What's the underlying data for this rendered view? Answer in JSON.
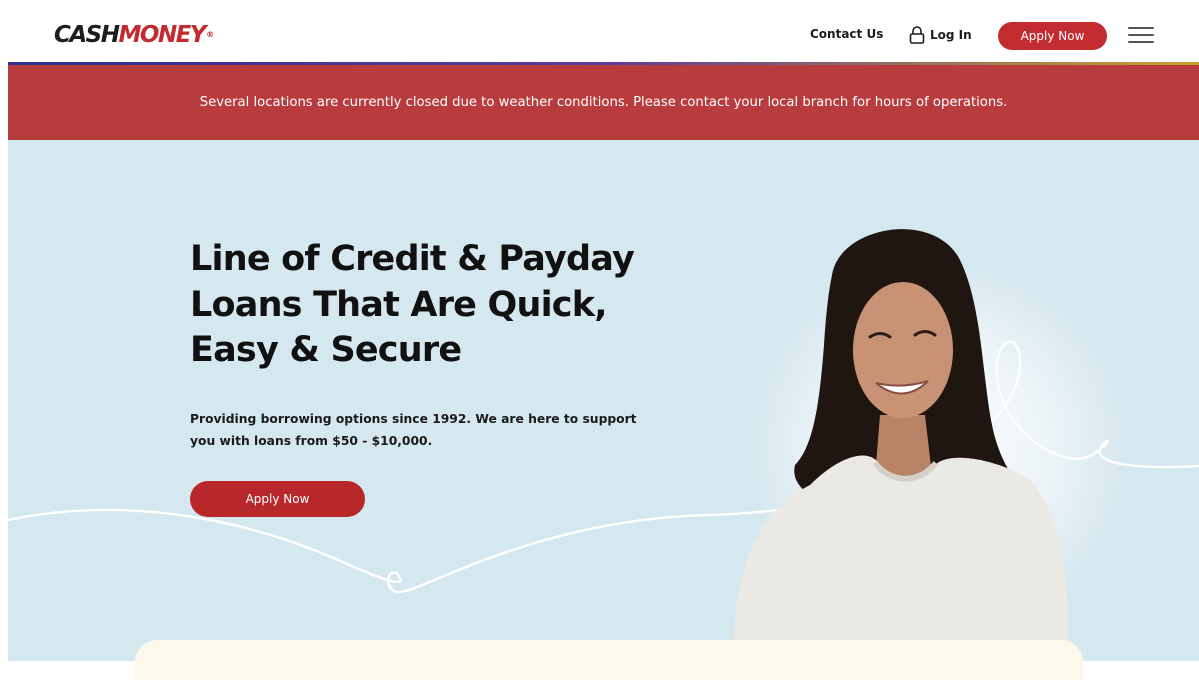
{
  "header": {
    "logo": {
      "part1": "CASH",
      "part2": "MONEY",
      "reg": "®"
    },
    "nav": {
      "contact": "Contact Us",
      "login": "Log In",
      "apply": "Apply Now"
    },
    "icons": [
      "lock-icon",
      "hamburger-menu-icon"
    ]
  },
  "alert": {
    "message": "Several locations are currently closed due to weather conditions. Please contact your local branch for hours of operations."
  },
  "hero": {
    "headline": "Line of Credit & Payday Loans That Are Quick, Easy & Secure",
    "subtext": "Providing borrowing options since 1992. We are here to support you with loans from $50 - $10,000.",
    "cta": "Apply Now"
  },
  "colors": {
    "brand_red": "#c22b2f",
    "alert_red": "#b83c3e",
    "hero_bg": "#d6e8ef",
    "card_bg": "#fdf9ea"
  }
}
